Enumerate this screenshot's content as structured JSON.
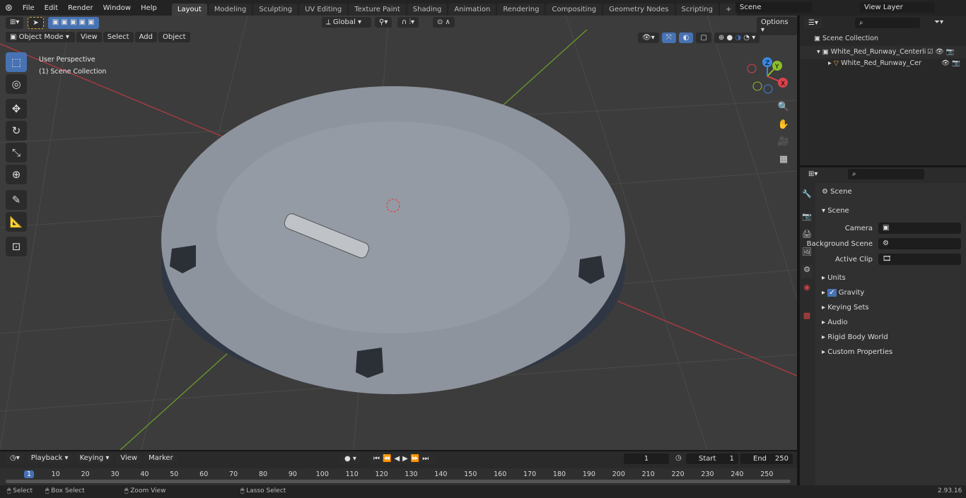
{
  "menu": [
    "File",
    "Edit",
    "Render",
    "Window",
    "Help"
  ],
  "workspaces": [
    "Layout",
    "Modeling",
    "Sculpting",
    "UV Editing",
    "Texture Paint",
    "Shading",
    "Animation",
    "Rendering",
    "Compositing",
    "Geometry Nodes",
    "Scripting"
  ],
  "scene_field": "Scene",
  "view_layer_field": "View Layer",
  "viewport": {
    "mode": "Object Mode",
    "menus": [
      "View",
      "Select",
      "Add",
      "Object"
    ],
    "transform_orientation": "Global",
    "options": "Options",
    "perspective_label": "User Perspective",
    "collection_label": "(1) Scene Collection",
    "axes": {
      "x": "X",
      "y": "Y",
      "z": "Z"
    }
  },
  "outliner": {
    "root": "Scene Collection",
    "collection": "White_Red_Runway_Centerli",
    "object": "White_Red_Runway_Cer"
  },
  "properties": {
    "header": "Scene",
    "panel": "Scene",
    "camera_label": "Camera",
    "background_label": "Background Scene",
    "clip_label": "Active Clip",
    "sections": [
      "Units",
      "Gravity",
      "Keying Sets",
      "Audio",
      "Rigid Body World",
      "Custom Properties"
    ],
    "gravity_checked": true
  },
  "timeline": {
    "menus": [
      "Playback",
      "Keying",
      "View",
      "Marker"
    ],
    "current_frame": "1",
    "start_label": "Start",
    "start": "1",
    "end_label": "End",
    "end": "250",
    "ticks": [
      "1",
      "10",
      "20",
      "30",
      "40",
      "50",
      "60",
      "70",
      "80",
      "90",
      "100",
      "110",
      "120",
      "130",
      "140",
      "150",
      "160",
      "170",
      "180",
      "190",
      "200",
      "210",
      "220",
      "230",
      "240",
      "250"
    ]
  },
  "status": {
    "select": "Select",
    "box_select": "Box Select",
    "zoom_view": "Zoom View",
    "lasso_select": "Lasso Select",
    "version": "2.93.16"
  },
  "colors": {
    "accent": "#4772b3",
    "x_axis": "#d9434f",
    "y_axis": "#8cbf2a",
    "z_axis": "#3b86e0"
  }
}
